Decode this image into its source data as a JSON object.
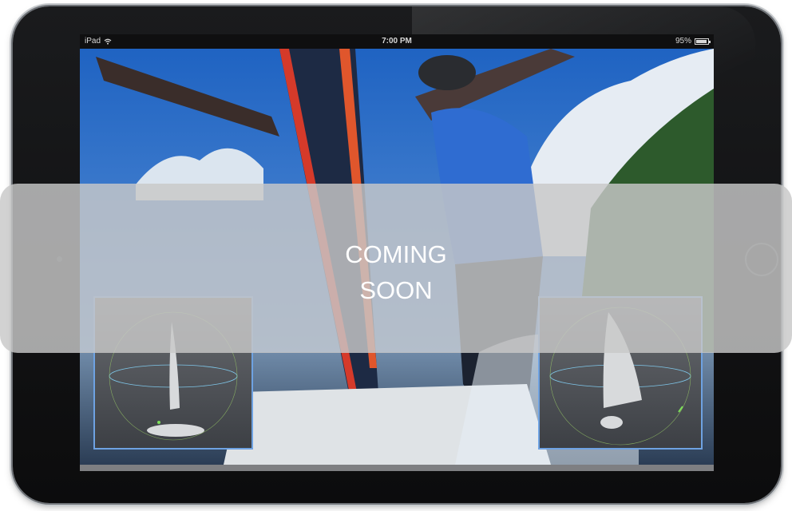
{
  "status_bar": {
    "device": "iPad",
    "wifi_icon": "wifi-icon",
    "time": "7:00 PM",
    "battery": "95%",
    "battery_icon": "battery-icon"
  },
  "overlay": {
    "line1": "COMING",
    "line2": "SOON"
  },
  "colors": {
    "sky": "#2f74c9",
    "sea": "#4e6a8a",
    "sail_red": "#d53a2a",
    "jersey": "#2f6cd1",
    "panel_border": "#6ea2e2",
    "overlay": "#c8c8c8"
  }
}
